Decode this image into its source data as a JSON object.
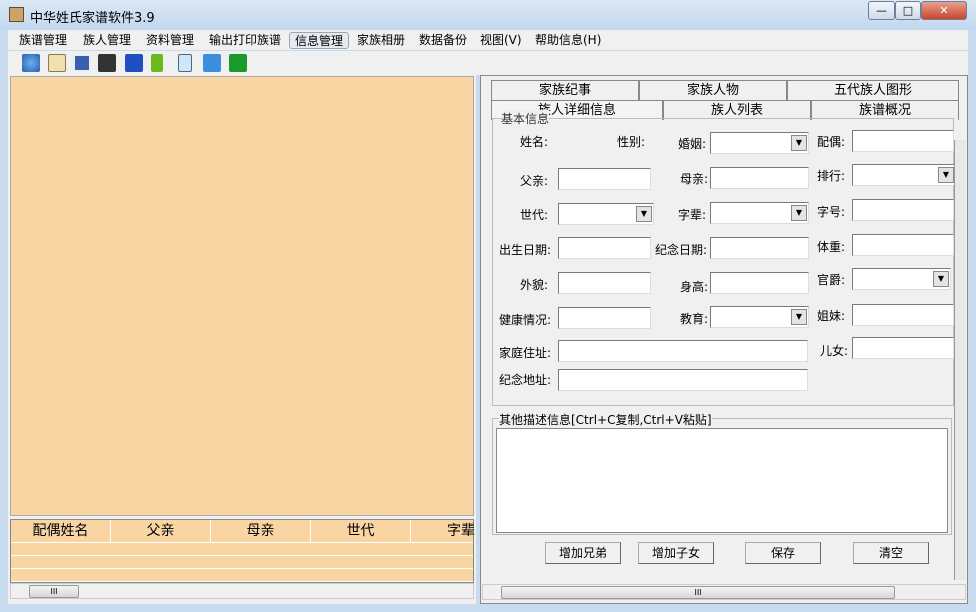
{
  "window": {
    "title": "中华姓氏家谱软件3.9",
    "min": "—",
    "max": "□",
    "close": "✕"
  },
  "menu": [
    "族谱管理",
    "族人管理",
    "资料管理",
    "输出打印族谱",
    "信息管理",
    "家族相册",
    "数据备份",
    "视图(V)",
    "帮助信息(H)"
  ],
  "toolbar_icons": [
    "globe-icon",
    "book-icon",
    "window-icon",
    "binoculars-icon",
    "save-icon",
    "up-arrow-icon",
    "document-icon",
    "copy-icon",
    "exit-icon"
  ],
  "grid": {
    "columns": [
      "配偶姓名",
      "父亲",
      "母亲",
      "世代",
      "字辈"
    ]
  },
  "tabs_top": [
    "家族纪事",
    "家族人物",
    "五代族人图形"
  ],
  "tabs_bottom": [
    "族人详细信息",
    "族人列表",
    "族谱概况"
  ],
  "group_title": "基本信息",
  "fields": {
    "name": "姓名:",
    "gender": "性别:",
    "marriage": "婚姻:",
    "spouse": "配偶:",
    "father": "父亲:",
    "mother": "母亲:",
    "rank": "排行:",
    "generation": "世代:",
    "zibei": "字辈:",
    "zihao": "字号:",
    "birth": "出生日期:",
    "memorial_date": "纪念日期:",
    "weight": "体重:",
    "appearance": "外貌:",
    "height": "身高:",
    "title": "官爵:",
    "health": "健康情况:",
    "education": "教育:",
    "sisters": "姐妹:",
    "address": "家庭住址:",
    "children": "儿女:",
    "memorial_address": "纪念地址:"
  },
  "desc_label": "其他描述信息[Ctrl+C复制,Ctrl+V粘贴]",
  "buttons": {
    "add_sibling": "增加兄弟",
    "add_child": "增加子女",
    "save": "保存",
    "clear": "清空"
  },
  "scroll_grip": "III"
}
